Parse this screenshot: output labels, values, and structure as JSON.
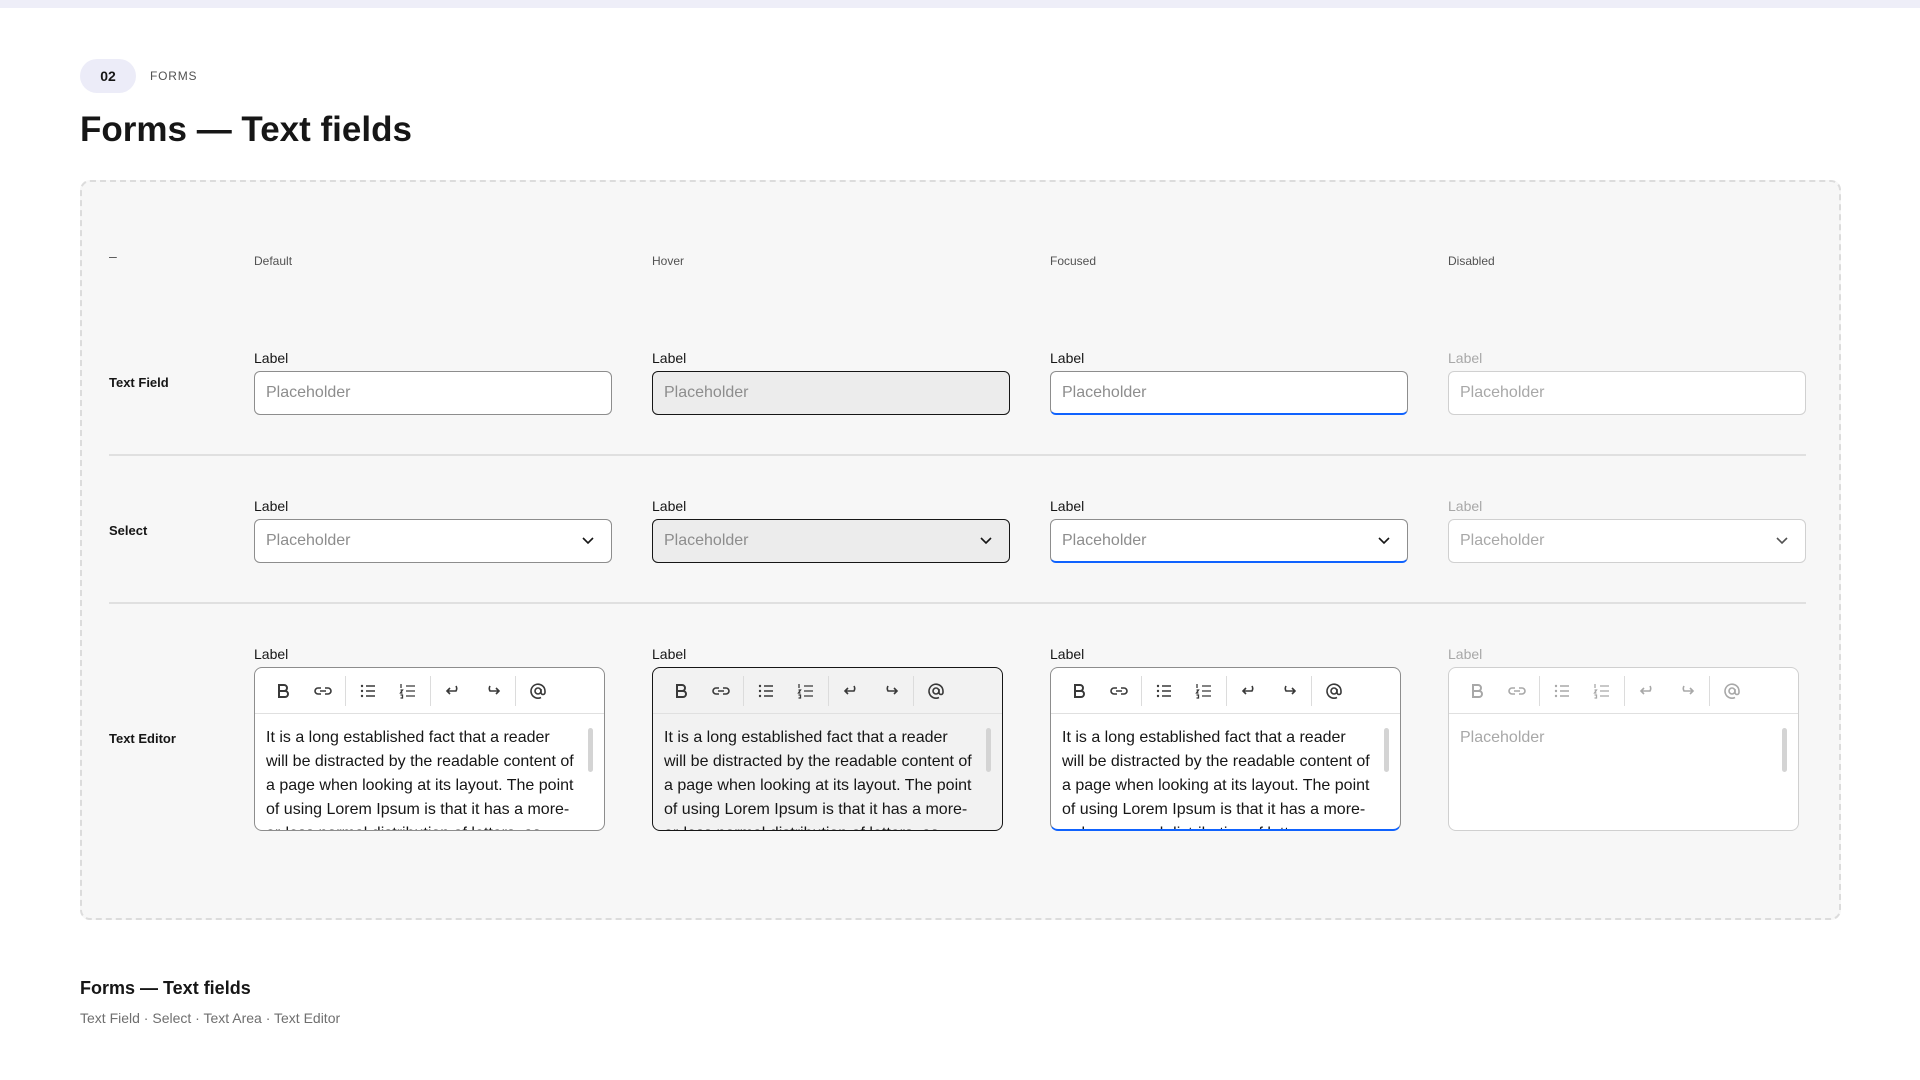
{
  "section": {
    "number": "02",
    "label": "FORMS"
  },
  "page_title": "Forms — Text fields",
  "board": {
    "corner": "–",
    "columns": [
      "Default",
      "Hover",
      "Focused",
      "Disabled"
    ],
    "rows": {
      "text_field": {
        "label": "Text Field",
        "field_label": "Label",
        "placeholder": "Placeholder"
      },
      "select": {
        "label": "Select",
        "field_label": "Label",
        "placeholder": "Placeholder"
      },
      "text_editor": {
        "label": "Text Editor",
        "field_label": "Label",
        "content": "It is a long established fact that a reader will be distracted by the readable content of a page when looking at its layout. The point of using Lorem Ipsum is that it has a more-or-less normal distribution of letters, as opposed to using 'Content here, content here'.",
        "disabled_placeholder": "Placeholder",
        "toolbar_icons": [
          "bold-icon",
          "link-icon",
          "bullet-list-icon",
          "numbered-list-icon",
          "undo-icon",
          "redo-icon",
          "mention-icon"
        ]
      }
    }
  },
  "colors": {
    "accent": "#0f62fe",
    "border": "#8d8d8d",
    "hover_border": "#161616",
    "disabled": "#a8a8a8"
  },
  "footer": {
    "title": "Forms — Text fields",
    "subtitle": "Text Field · Select · Text Area · Text Editor"
  }
}
